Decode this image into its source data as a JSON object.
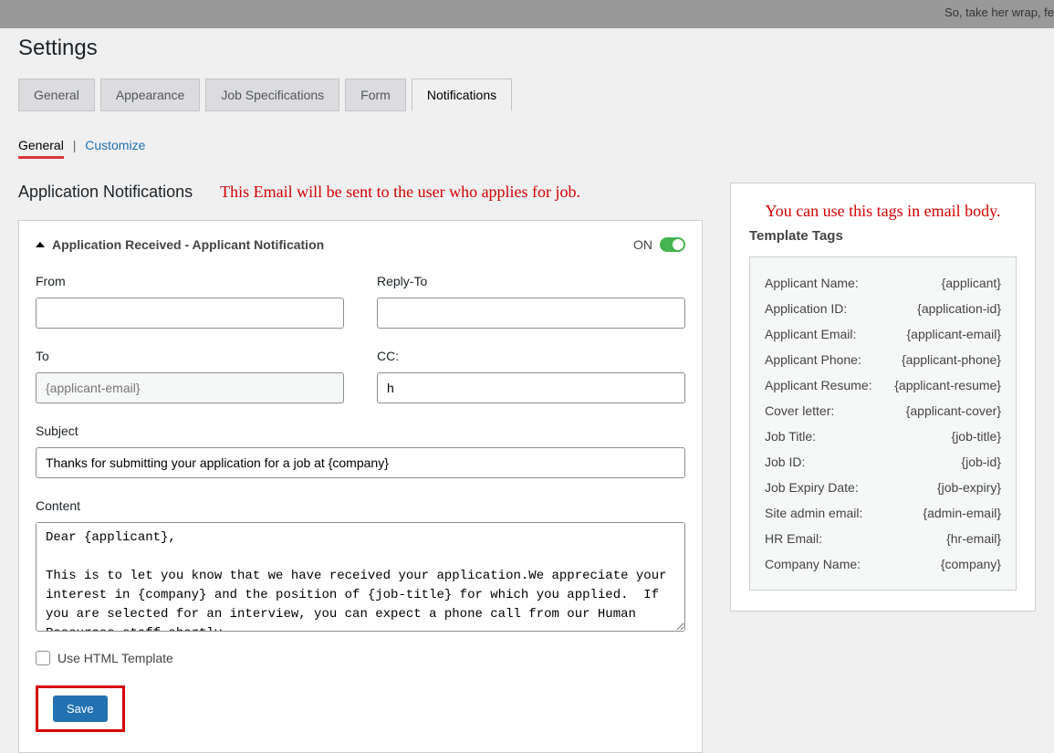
{
  "topbar": {
    "text": "So, take her wrap, fe"
  },
  "page_title": "Settings",
  "tabs": [
    {
      "label": "General",
      "active": false
    },
    {
      "label": "Appearance",
      "active": false
    },
    {
      "label": "Job Specifications",
      "active": false
    },
    {
      "label": "Form",
      "active": false
    },
    {
      "label": "Notifications",
      "active": true
    }
  ],
  "subtabs": {
    "active": "General",
    "other": "Customize"
  },
  "section": {
    "heading": "Application Notifications",
    "note": "This Email will be sent to the user who applies for job."
  },
  "accordion": {
    "title": "Application Received - Applicant Notification",
    "toggle_label": "ON",
    "toggle_state": true
  },
  "form": {
    "from": {
      "label": "From",
      "value": ""
    },
    "reply_to": {
      "label": "Reply-To",
      "value": ""
    },
    "to": {
      "label": "To",
      "value": "{applicant-email}"
    },
    "cc": {
      "label": "CC:",
      "value": "h"
    },
    "subject": {
      "label": "Subject",
      "value": "Thanks for submitting your application for a job at {company}"
    },
    "content": {
      "label": "Content",
      "value": "Dear {applicant},\n\nThis is to let you know that we have received your application.We appreciate your interest in {company} and the position of {job-title} for which you applied.  If you are selected for an interview, you can expect a phone call from our Human Resources staff shortly."
    },
    "use_html": {
      "label": "Use HTML Template",
      "checked": false
    },
    "save_label": "Save"
  },
  "sidebar": {
    "note": "You can use this tags in email body.",
    "title": "Template Tags",
    "tags": [
      {
        "label": "Applicant Name:",
        "tag": "{applicant}"
      },
      {
        "label": "Application ID:",
        "tag": "{application-id}"
      },
      {
        "label": "Applicant Email:",
        "tag": "{applicant-email}"
      },
      {
        "label": "Applicant Phone:",
        "tag": "{applicant-phone}"
      },
      {
        "label": "Applicant Resume:",
        "tag": "{applicant-resume}"
      },
      {
        "label": "Cover letter:",
        "tag": "{applicant-cover}"
      },
      {
        "label": "Job Title:",
        "tag": "{job-title}"
      },
      {
        "label": "Job ID:",
        "tag": "{job-id}"
      },
      {
        "label": "Job Expiry Date:",
        "tag": "{job-expiry}"
      },
      {
        "label": "Site admin email:",
        "tag": "{admin-email}"
      },
      {
        "label": "HR Email:",
        "tag": "{hr-email}"
      },
      {
        "label": "Company Name:",
        "tag": "{company}"
      }
    ]
  }
}
